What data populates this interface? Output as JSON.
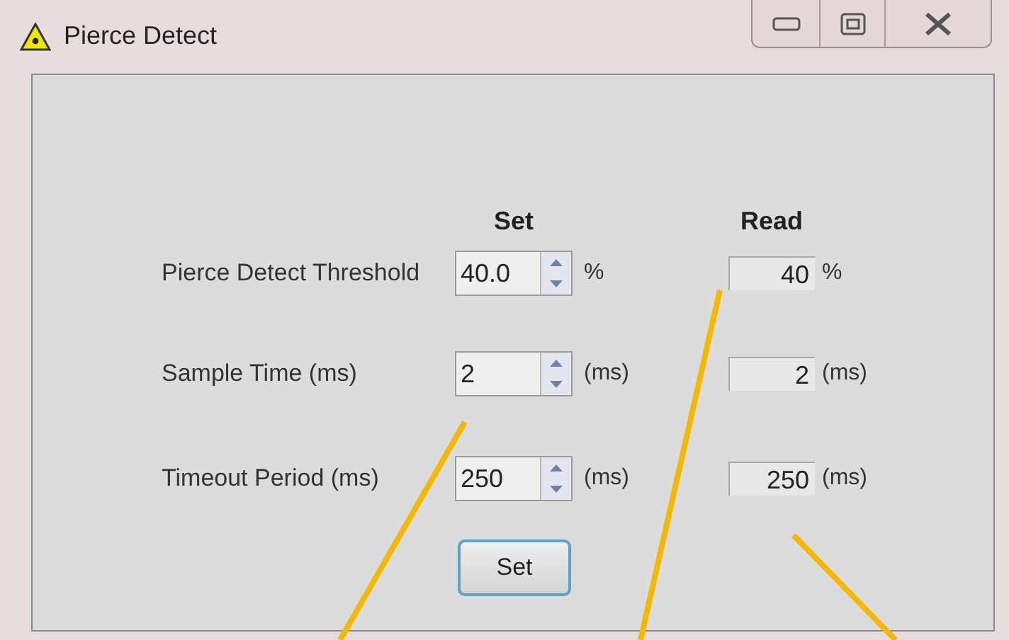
{
  "window": {
    "title": "Pierce Detect"
  },
  "columns": {
    "set": "Set",
    "read": "Read"
  },
  "rows": [
    {
      "label": "Pierce Detect Threshold",
      "set_value": "40.0",
      "set_unit": "%",
      "read_value": "40",
      "read_unit": "%"
    },
    {
      "label": "Sample Time (ms)",
      "set_value": "2",
      "set_unit": "(ms)",
      "read_value": "2",
      "read_unit": "(ms)"
    },
    {
      "label": "Timeout Period (ms)",
      "set_value": "250",
      "set_unit": "(ms)",
      "read_value": "250",
      "read_unit": "(ms)"
    }
  ],
  "button": "Set"
}
